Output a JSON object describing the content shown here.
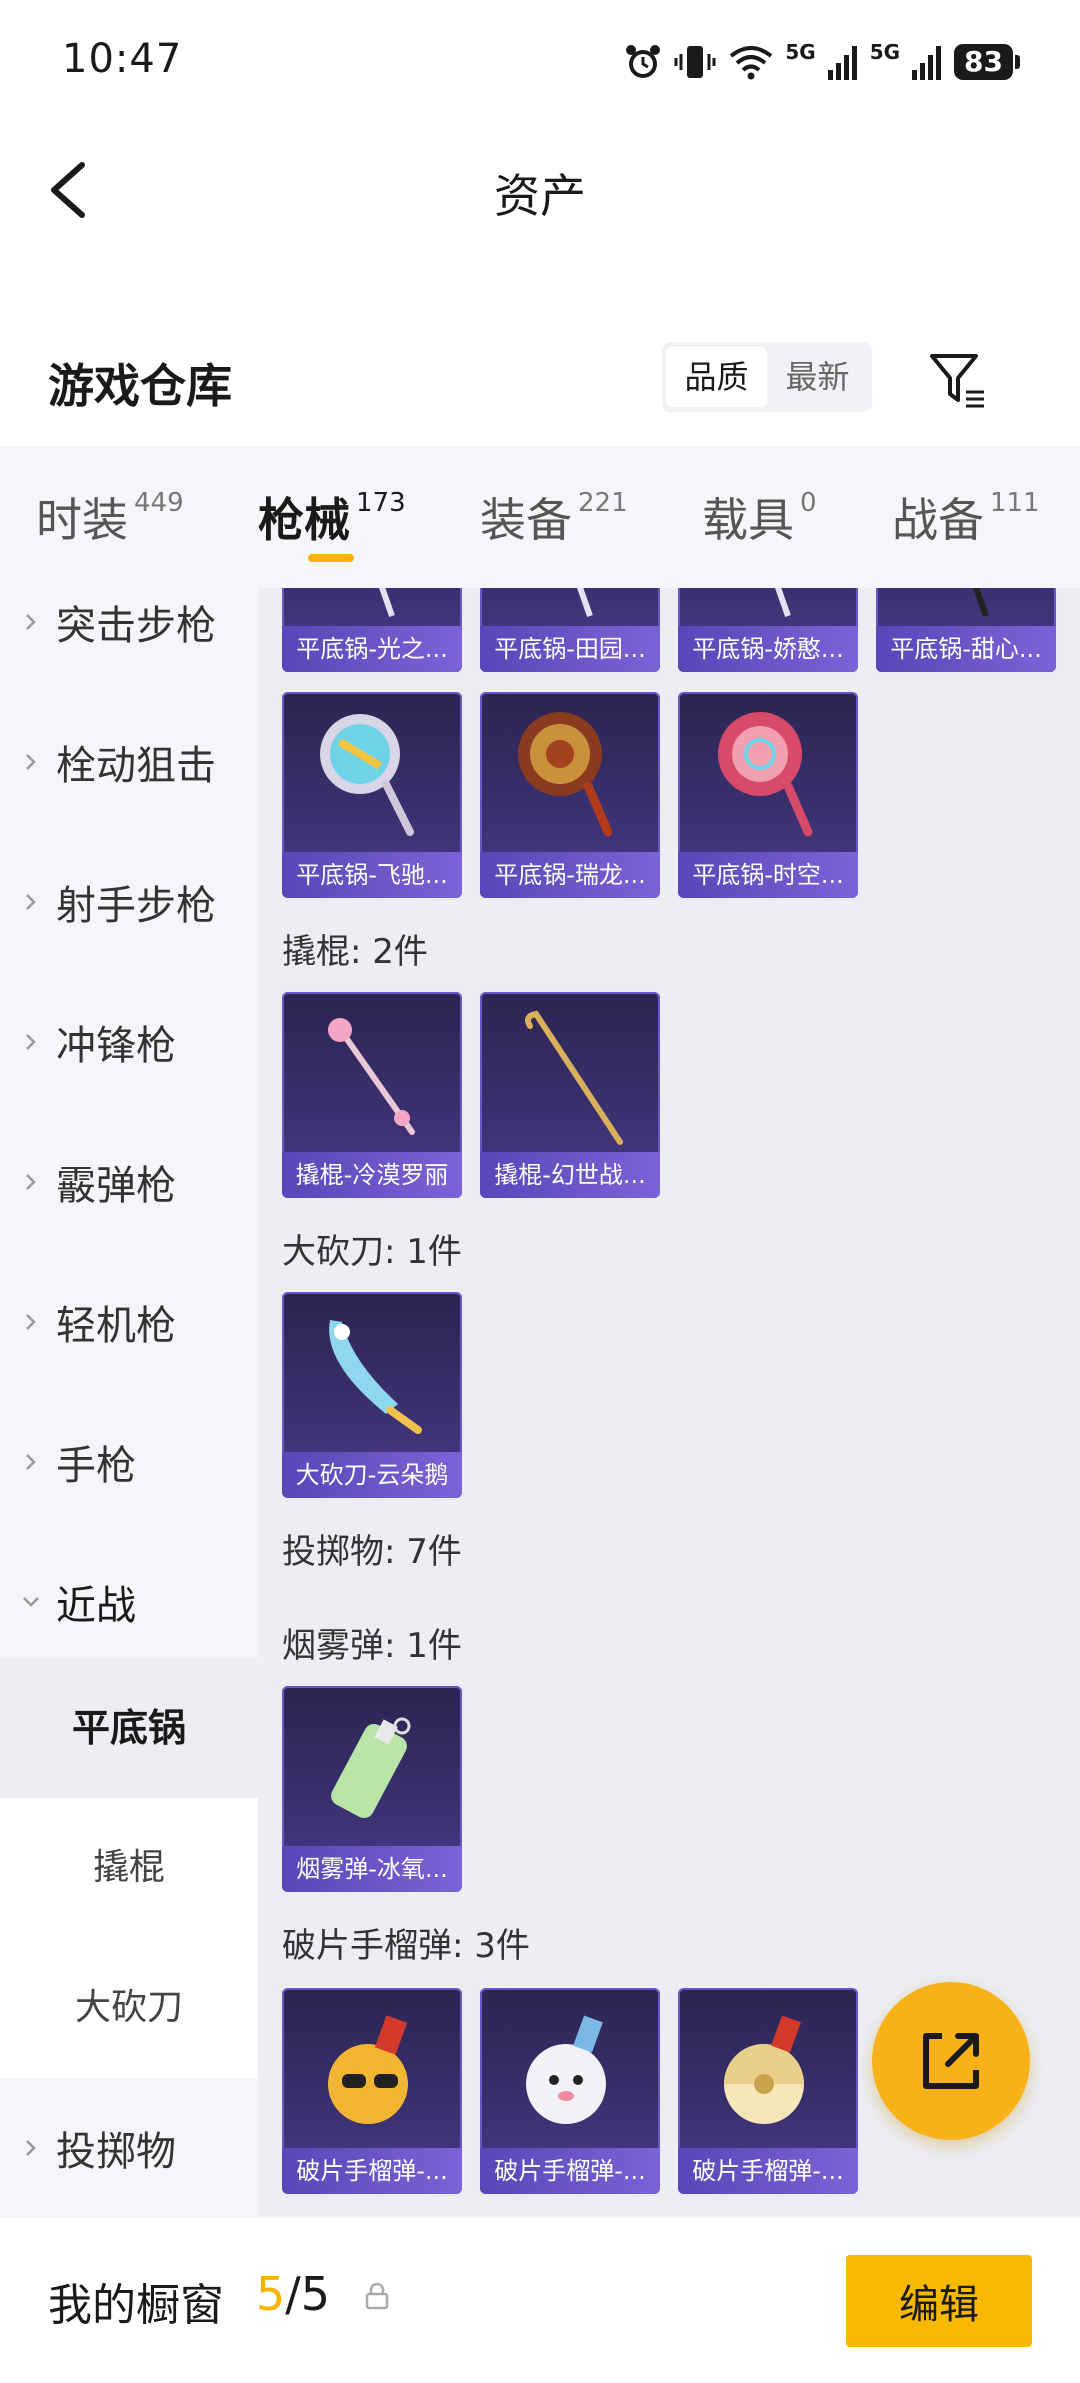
{
  "status_bar": {
    "time": "10:47",
    "battery": "83",
    "network_1": "5G",
    "network_2": "5G"
  },
  "nav": {
    "title": "资产"
  },
  "warehouse": {
    "title": "游戏仓库",
    "sort_options": [
      "品质",
      "最新"
    ],
    "sort_selected": "品质"
  },
  "tabs": [
    {
      "label": "时装",
      "count": "449"
    },
    {
      "label": "枪械",
      "count": "173"
    },
    {
      "label": "装备",
      "count": "221"
    },
    {
      "label": "载具",
      "count": "0"
    },
    {
      "label": "战备",
      "count": "111"
    }
  ],
  "active_tab": "枪械",
  "sidebar": {
    "items": [
      "突击步枪",
      "栓动狙击",
      "射手步枪",
      "冲锋枪",
      "霰弹枪",
      "轻机枪",
      "手枪",
      "近战",
      "投掷物"
    ],
    "expanded": "近战",
    "sub_items": [
      "平底锅",
      "撬棍",
      "大砍刀"
    ],
    "selected_sub": "平底锅"
  },
  "groups": {
    "pan_row1": [
      "平底锅-光之...",
      "平底锅-田园...",
      "平底锅-娇憨...",
      "平底锅-甜心..."
    ],
    "pan_row2": [
      "平底锅-飞驰...",
      "平底锅-瑞龙...",
      "平底锅-时空..."
    ],
    "crowbar_title": "撬棍: 2件",
    "crowbar": [
      "撬棍-冷漠罗丽",
      "撬棍-幻世战..."
    ],
    "machete_title": "大砍刀: 1件",
    "machete": [
      "大砍刀-云朵鹅"
    ],
    "throwable_title": "投掷物: 7件",
    "smoke_title": "烟雾弹: 1件",
    "smoke": [
      "烟雾弹-冰氧..."
    ],
    "frag_title": "破片手榴弹: 3件",
    "frag": [
      "破片手榴弹-...",
      "破片手榴弹-...",
      "破片手榴弹-..."
    ]
  },
  "bottom": {
    "showcase_label": "我的橱窗",
    "showcase_current": "5",
    "showcase_total": "/5",
    "edit_label": "编辑"
  },
  "colors": {
    "accent": "#f6b400",
    "card_label": "#6a55c8"
  }
}
